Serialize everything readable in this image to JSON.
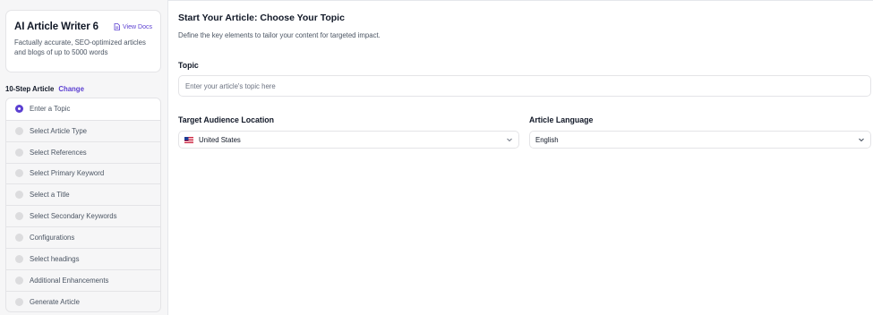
{
  "sidebar": {
    "card": {
      "title": "AI Article Writer 6",
      "docs_label": "View Docs",
      "description": "Factually accurate, SEO-optimized articles and blogs of up to 5000 words"
    },
    "steps_title": "10-Step Article",
    "change_label": "Change",
    "steps": [
      {
        "label": "Enter a Topic",
        "active": true
      },
      {
        "label": "Select Article Type",
        "active": false
      },
      {
        "label": "Select References",
        "active": false
      },
      {
        "label": "Select Primary Keyword",
        "active": false
      },
      {
        "label": "Select a Title",
        "active": false
      },
      {
        "label": "Select Secondary Keywords",
        "active": false
      },
      {
        "label": "Configurations",
        "active": false
      },
      {
        "label": "Select headings",
        "active": false
      },
      {
        "label": "Additional Enhancements",
        "active": false
      },
      {
        "label": "Generate Article",
        "active": false
      }
    ]
  },
  "main": {
    "title": "Start Your Article: Choose Your Topic",
    "subtitle": "Define the key elements to tailor your content for targeted impact.",
    "topic": {
      "label": "Topic",
      "value": "",
      "placeholder": "Enter your article's topic here"
    },
    "location": {
      "label": "Target Audience Location",
      "selected": "United States",
      "icon": "us-flag-icon"
    },
    "language": {
      "label": "Article Language",
      "selected": "English"
    }
  },
  "colors": {
    "accent": "#5b3fd1",
    "sidebar_bg": "#f6f6f7",
    "border": "#e4e4e7"
  }
}
